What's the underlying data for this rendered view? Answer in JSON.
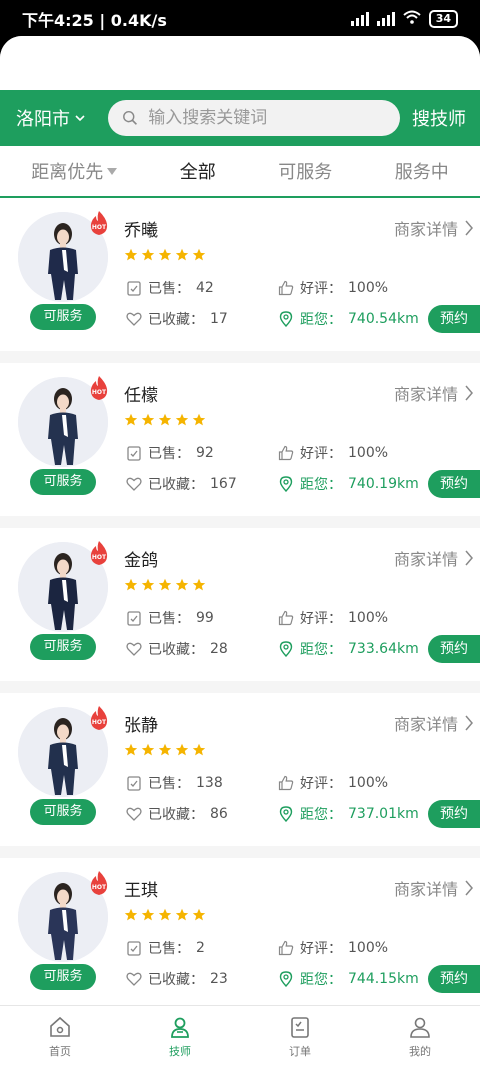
{
  "status_bar": {
    "time_speed": "下午4:25 | 0.4K/s",
    "battery": "34"
  },
  "search": {
    "city": "洛阳市",
    "placeholder": "输入搜索关键词",
    "button": "搜技师"
  },
  "filters": [
    {
      "label": "距离优先"
    },
    {
      "label": "全部"
    },
    {
      "label": "可服务"
    },
    {
      "label": "服务中"
    }
  ],
  "common": {
    "detail_label": "商家详情",
    "status_label": "可服务",
    "book_label": "预约",
    "sold_prefix": "已售：",
    "fav_prefix": "已收藏：",
    "rating_prefix": "好评：",
    "dist_prefix": "距您：",
    "hot_text": "HOT"
  },
  "technicians": [
    {
      "name": "乔曦",
      "sold": "42",
      "favorites": "17",
      "rating": "100%",
      "distance": "740.54km",
      "stars": 5
    },
    {
      "name": "任檬",
      "sold": "92",
      "favorites": "167",
      "rating": "100%",
      "distance": "740.19km",
      "stars": 5
    },
    {
      "name": "金鸽",
      "sold": "99",
      "favorites": "28",
      "rating": "100%",
      "distance": "733.64km",
      "stars": 5
    },
    {
      "name": "张静",
      "sold": "138",
      "favorites": "86",
      "rating": "100%",
      "distance": "737.01km",
      "stars": 5
    },
    {
      "name": "王琪",
      "sold": "2",
      "favorites": "23",
      "rating": "100%",
      "distance": "744.15km",
      "stars": 5
    }
  ],
  "tabs": [
    {
      "label": "首页",
      "icon": "home-icon"
    },
    {
      "label": "技师",
      "icon": "technician-icon"
    },
    {
      "label": "订单",
      "icon": "order-icon"
    },
    {
      "label": "我的",
      "icon": "profile-icon"
    }
  ],
  "colors": {
    "brand_green": "#1e9e5e",
    "star": "#f5b400",
    "hot": "#e8413c"
  }
}
